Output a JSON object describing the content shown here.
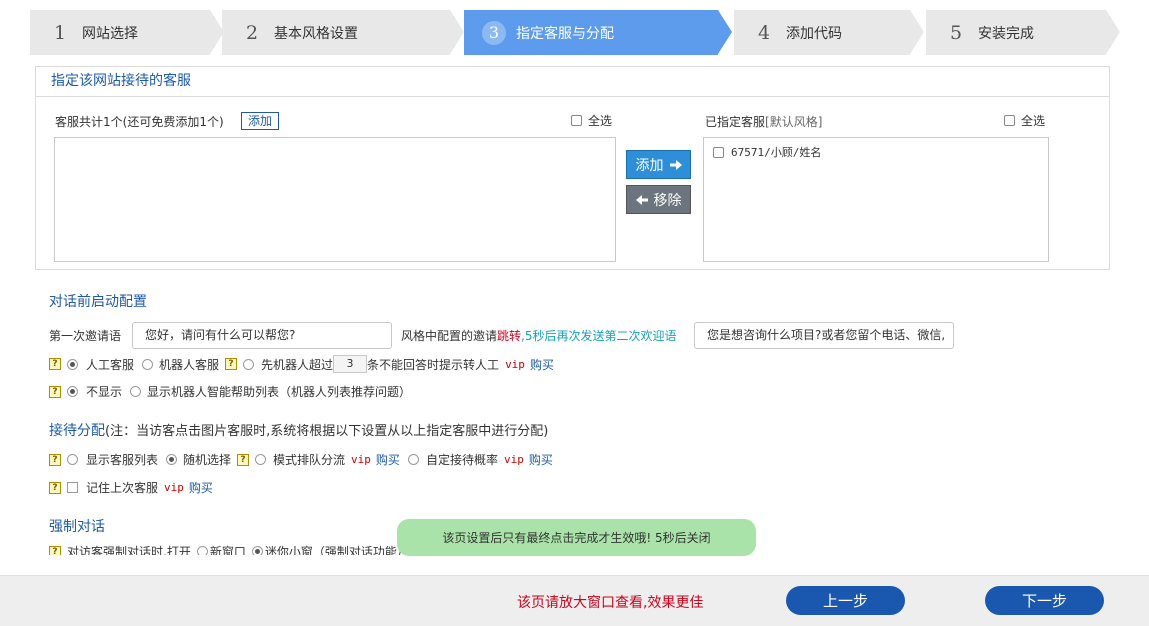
{
  "steps": [
    {
      "num": "1",
      "label": "网站选择"
    },
    {
      "num": "2",
      "label": "基本风格设置"
    },
    {
      "num": "3",
      "label": "指定客服与分配"
    },
    {
      "num": "4",
      "label": "添加代码"
    },
    {
      "num": "5",
      "label": "安装完成"
    }
  ],
  "colors": {
    "active_step": "#5d9cec",
    "primary": "#1a58b0",
    "warn": "#d0021b",
    "toast": "#a9e3a9"
  },
  "panel": {
    "title": "指定该网站接待的客服",
    "left_count": "客服共计1个(还可免费添加1个)",
    "add_link": "添加",
    "select_all": "全选",
    "right_title": "已指定客服",
    "right_title_note": "[默认风格]",
    "assigned": [
      "67571/小顾/姓名"
    ],
    "add_button": "添加",
    "remove_button": "移除"
  },
  "pre_chat": {
    "title": "对话前启动配置",
    "first_invite_label": "第一次邀请语",
    "first_invite_value": "您好，请问有什么可以帮您?",
    "style_invite_prefix": "风格中配置的邀请",
    "style_invite_jump": "跳转",
    "style_invite_suffix": ",5秒后再次发送第二次欢迎语",
    "second_invite_value": "您是想咨询什么项目?或者您留个电话、微信,",
    "opt_human": "人工客服",
    "opt_robot": "机器人客服",
    "opt_robot_first": "先机器人超过",
    "robot_count": "3",
    "opt_robot_first_suffix": "条不能回答时提示转人工",
    "vip": "vip",
    "buy": "购买",
    "opt_hide": "不显示",
    "opt_show_robot": "显示机器人智能帮助列表（机器人列表推荐问题）"
  },
  "dispatch": {
    "title": "接待分配",
    "note": "(注：当访客点击图片客服时,系统将根据以下设置从以上指定客服中进行分配)",
    "opt_list": "显示客服列表",
    "opt_random": "随机选择",
    "opt_queue": "模式排队分流",
    "opt_custom": "自定接待概率",
    "opt_remember": "记住上次客服"
  },
  "force_chat": {
    "title": "强制对话",
    "text": "对访客强制对话时,打开",
    "opt_new": "新窗口",
    "opt_mini": "迷你小窗（强制对话功能）"
  },
  "toast": "该页设置后只有最终点击完成才生效哦! 5秒后关闭",
  "bottom": {
    "note": "该页请放大窗口查看,效果更佳",
    "prev": "上一步",
    "next": "下一步"
  }
}
